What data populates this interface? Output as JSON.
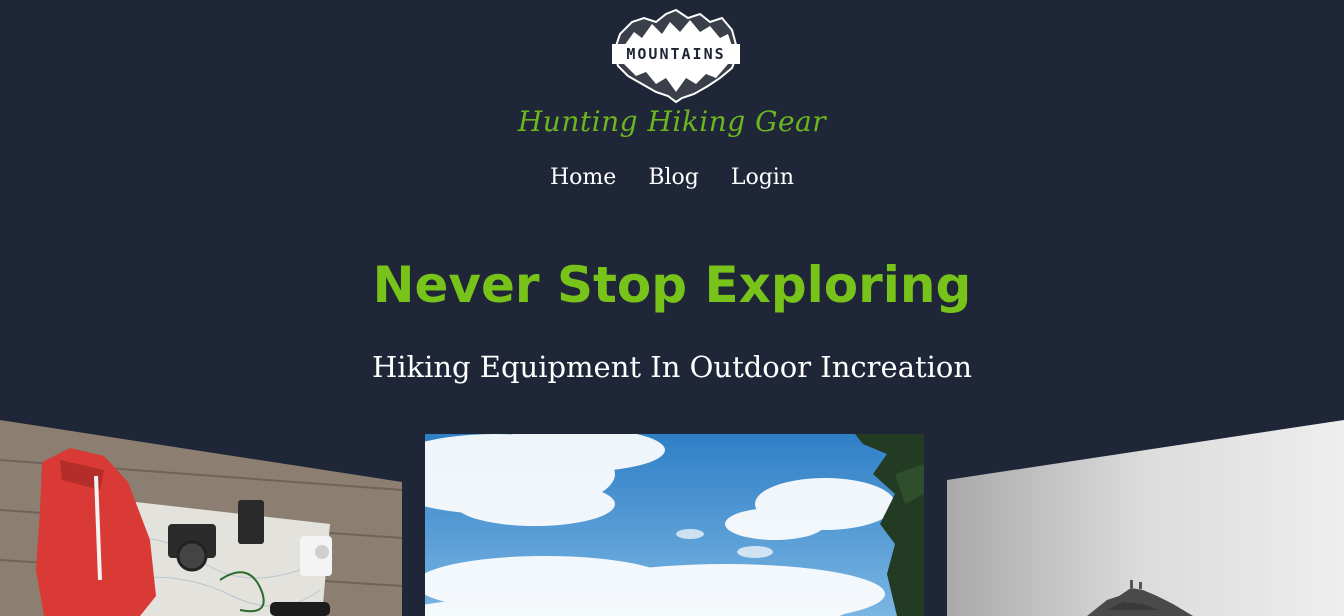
{
  "brand": {
    "logo_word": "MOUNTAINS",
    "site_title": "Hunting Hiking Gear"
  },
  "nav": {
    "items": [
      "Home",
      "Blog",
      "Login"
    ]
  },
  "hero": {
    "title": "Never Stop Exploring",
    "subtitle": "Hiking Equipment In Outdoor Increation"
  },
  "colors": {
    "background": "#1f2637",
    "accent_green": "#78c31a",
    "title_green": "#6bb51f",
    "nav_text": "#ffffff"
  },
  "gallery": {
    "images": [
      "gear-flatlay-photo",
      "sky-clouds-photo",
      "mountain-summit-photo"
    ]
  }
}
